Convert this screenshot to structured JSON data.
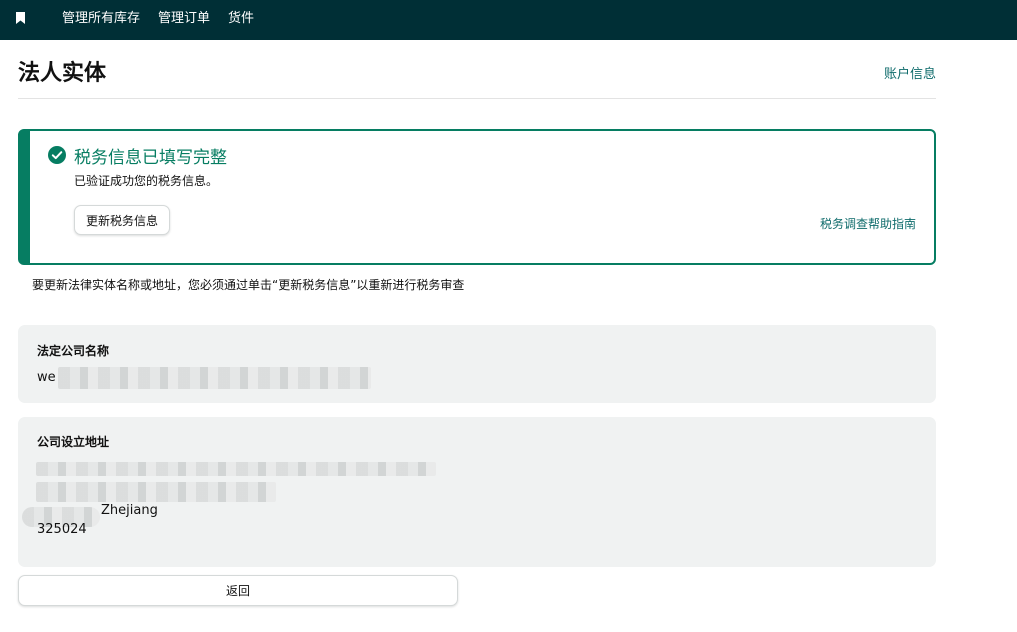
{
  "nav": {
    "bookmark_icon": "bookmark-icon",
    "items": [
      {
        "label": "管理所有库存"
      },
      {
        "label": "管理订单"
      },
      {
        "label": "货件"
      }
    ],
    "background": "#002f36"
  },
  "page": {
    "title": "法人实体",
    "account_link": "账户信息"
  },
  "alert": {
    "icon": "check-circle-icon",
    "title": "税务信息已填写完整",
    "subtitle": "已验证成功您的税务信息。",
    "update_button": "更新税务信息",
    "help_link": "税务调查帮助指南",
    "accent": "#067d62"
  },
  "note": "要更新法律实体名称或地址，您必须通过单击“更新税务信息”以重新进行税务审查",
  "company_name": {
    "label": "法定公司名称",
    "value": "we"
  },
  "company_address": {
    "label": "公司设立地址",
    "line_province": "Zhejiang",
    "postal_code": "325024"
  },
  "back_button": "返回"
}
